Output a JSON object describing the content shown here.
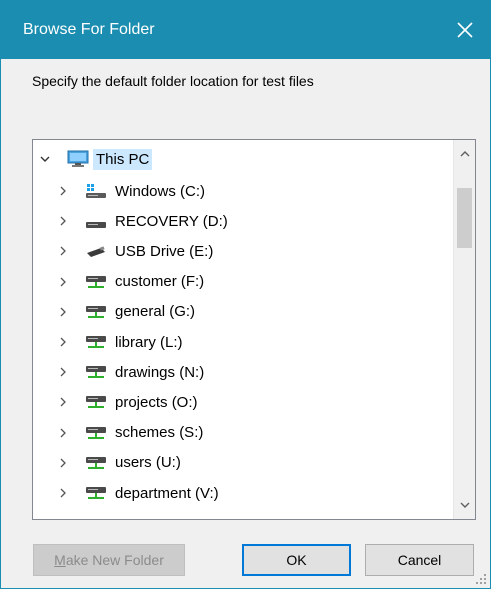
{
  "window": {
    "title": "Browse For Folder",
    "accent_color": "#1a8db0"
  },
  "prompt_text": "Specify the default folder location for test files",
  "tree": {
    "root": {
      "label": "This PC",
      "icon": "monitor-icon",
      "expanded": true,
      "selected": true
    },
    "items": [
      {
        "label": "Windows (C:)",
        "icon": "windows-drive-icon"
      },
      {
        "label": "RECOVERY (D:)",
        "icon": "drive-icon"
      },
      {
        "label": "USB Drive (E:)",
        "icon": "usb-drive-icon"
      },
      {
        "label": "customer (F:)",
        "icon": "network-drive-icon"
      },
      {
        "label": "general (G:)",
        "icon": "network-drive-icon"
      },
      {
        "label": "library (L:)",
        "icon": "network-drive-icon"
      },
      {
        "label": "drawings (N:)",
        "icon": "network-drive-icon"
      },
      {
        "label": "projects (O:)",
        "icon": "network-drive-icon"
      },
      {
        "label": "schemes (S:)",
        "icon": "network-drive-icon"
      },
      {
        "label": "users (U:)",
        "icon": "network-drive-icon"
      },
      {
        "label": "department  (V:)",
        "icon": "network-drive-icon"
      }
    ]
  },
  "buttons": {
    "new_folder_prefix": "M",
    "new_folder_rest": "ake New Folder",
    "ok": "OK",
    "cancel": "Cancel"
  }
}
